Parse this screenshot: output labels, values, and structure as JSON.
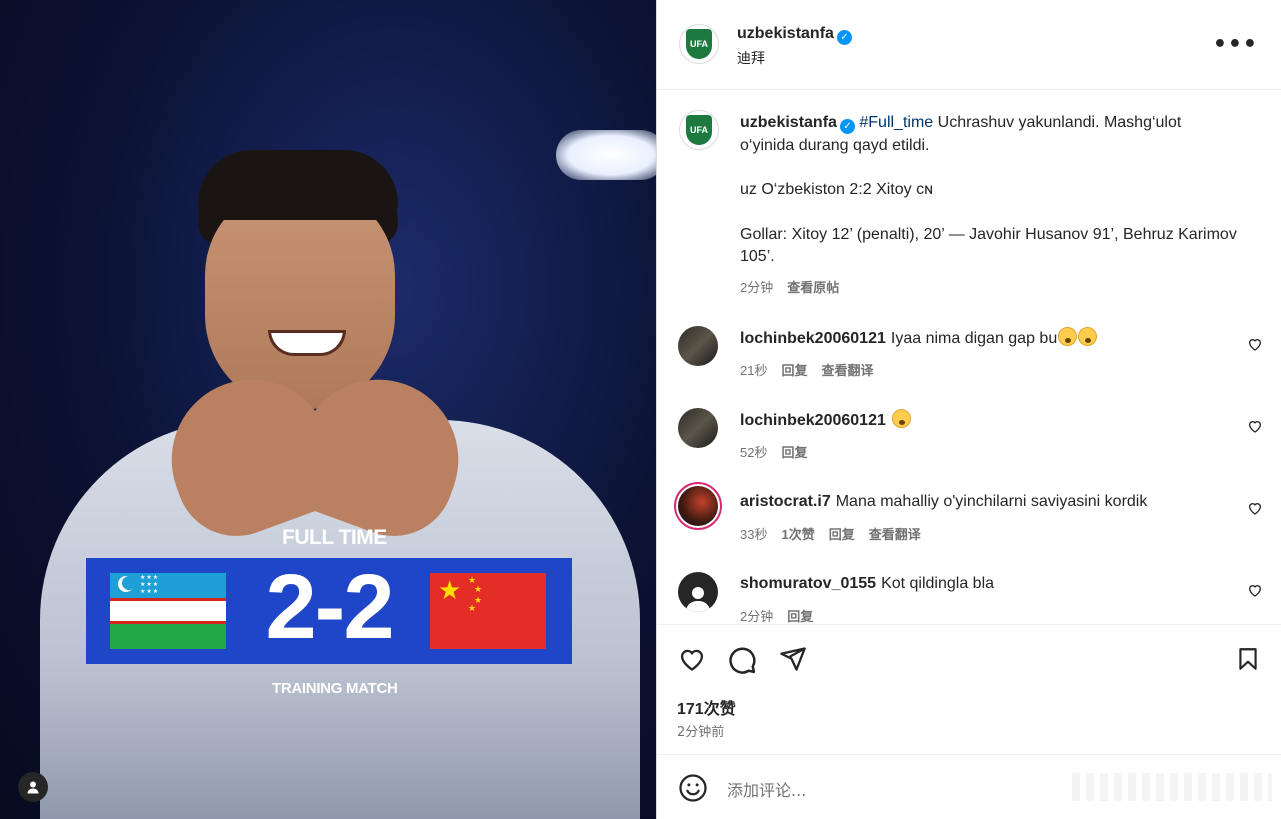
{
  "post": {
    "username": "uzbekistanfa",
    "location": "迪拜",
    "more_icon": "more-horizontal-icon",
    "logo_text": "UFA"
  },
  "media": {
    "full_time": "FULL TIME",
    "score": "2-2",
    "training": "TRAINING MATCH"
  },
  "caption": {
    "username": "uzbekistanfa",
    "hashtag": "#Full_time",
    "line1": " Uchrashuv yakunlandi. Mashg‘ulot o‘yinida durang qayd etildi.",
    "line2": "uz O‘zbekiston 2:2 Xitoy ᴄɴ",
    "line3": "Gollar: Xitoy 12’ (penalti), 20’ — Javohir Husanov 91’, Behruz Karimov 105’.",
    "time": "2分钟",
    "see_original": "查看原帖"
  },
  "comments": [
    {
      "user": "lochinbek20060121",
      "text": "Iyaa nima digan gap bu",
      "time": "21秒",
      "reply": "回复",
      "likes": "",
      "translate": "查看翻译"
    },
    {
      "user": "lochinbek20060121",
      "text": "",
      "time": "52秒",
      "reply": "回复",
      "likes": "",
      "translate": ""
    },
    {
      "user": "aristocrat.i7",
      "text": "Mana mahalliy o'yinchilarni saviyasini kordik",
      "time": "33秒",
      "reply": "回复",
      "likes": "1次赞",
      "translate": "查看翻译"
    },
    {
      "user": "shomuratov_0155",
      "text": "Kot qildingla bla",
      "time": "2分钟",
      "reply": "回复",
      "likes": "",
      "translate": ""
    }
  ],
  "actions": {
    "likes": "171次赞",
    "posted": "2分钟前"
  },
  "composer": {
    "placeholder": "添加评论..."
  },
  "colors": {
    "verified": "#0095f6",
    "score_box": "#1f46c8",
    "hashtag": "#00376b"
  }
}
